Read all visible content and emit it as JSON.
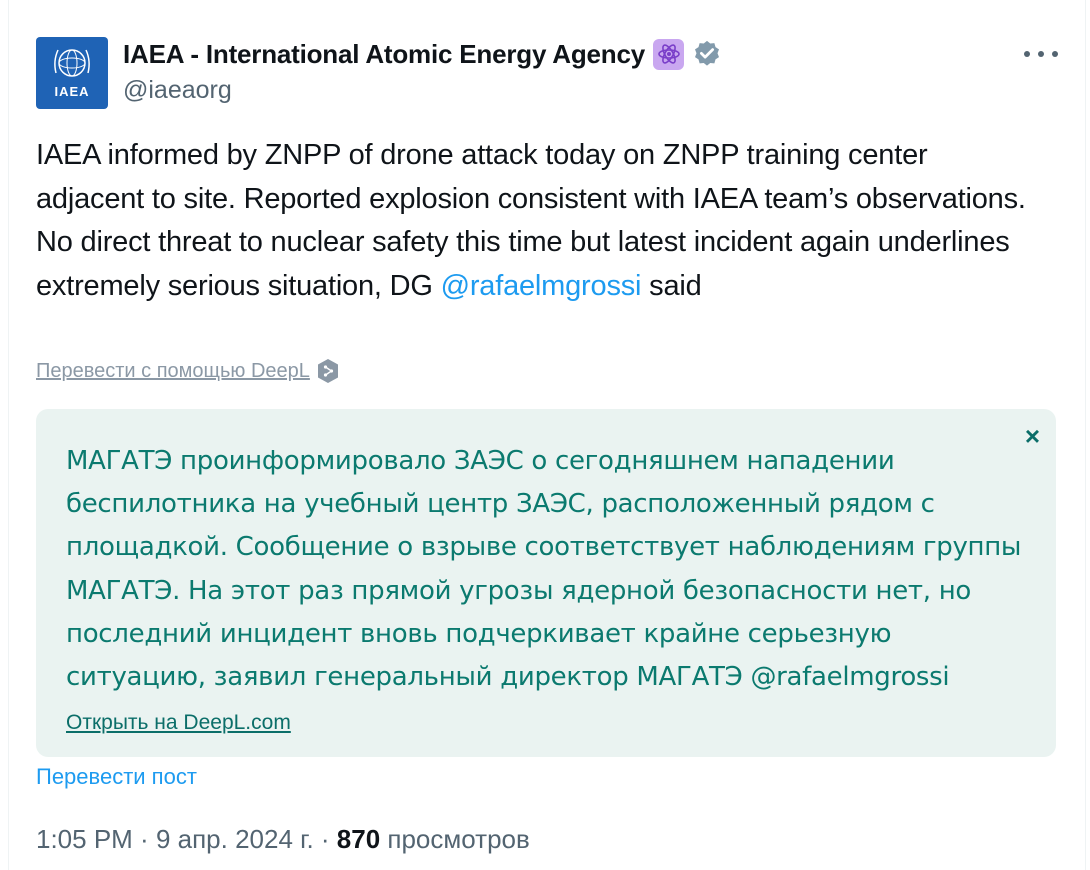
{
  "author": {
    "display_name": "IAEA - International Atomic Energy Agency",
    "handle": "@iaeaorg",
    "avatar_text": "IAEA",
    "badges": [
      "atom-emoji-badge",
      "verified-gray-checkmark"
    ]
  },
  "tweet": {
    "text_main": "IAEA informed by ZNPP of drone attack today on ZNPP training center adjacent to site. Reported explosion consistent with IAEA team’s observations. No direct threat to nuclear safety this time but latest incident again underlines extremely serious situation, DG ",
    "mention": "@rafaelmgrossi",
    "text_tail": " said"
  },
  "deepl": {
    "translate_link": "Перевести с помощью DeepL",
    "translation_text": "МАГАТЭ проинформировало ЗАЭС о сегодняшнем нападении беспилотника на учебный центр ЗАЭС, расположенный рядом с площадкой. Сообщение о взрыве соответствует наблюдениям группы МАГАТЭ. На этот раз прямой угрозы ядерной безопасности нет, но последний инцидент вновь подчеркивает крайне серьезную ситуацию, заявил генеральный директор МАГАТЭ @rafaelmgrossi",
    "close_symbol": "×",
    "open_link": "Открыть на DeepL.com"
  },
  "translate_post": "Перевести пост",
  "meta": {
    "time": "1:05 PM",
    "sep1": " · ",
    "date": "9 апр. 2024 г.",
    "sep2": " · ",
    "views_count": "870",
    "views_label": " просмотров"
  },
  "colors": {
    "link": "#1d9bf0",
    "translation_bg": "#eaf3f1",
    "translation_text": "#0b7a6f",
    "avatar_bg": "#1f63b5"
  }
}
